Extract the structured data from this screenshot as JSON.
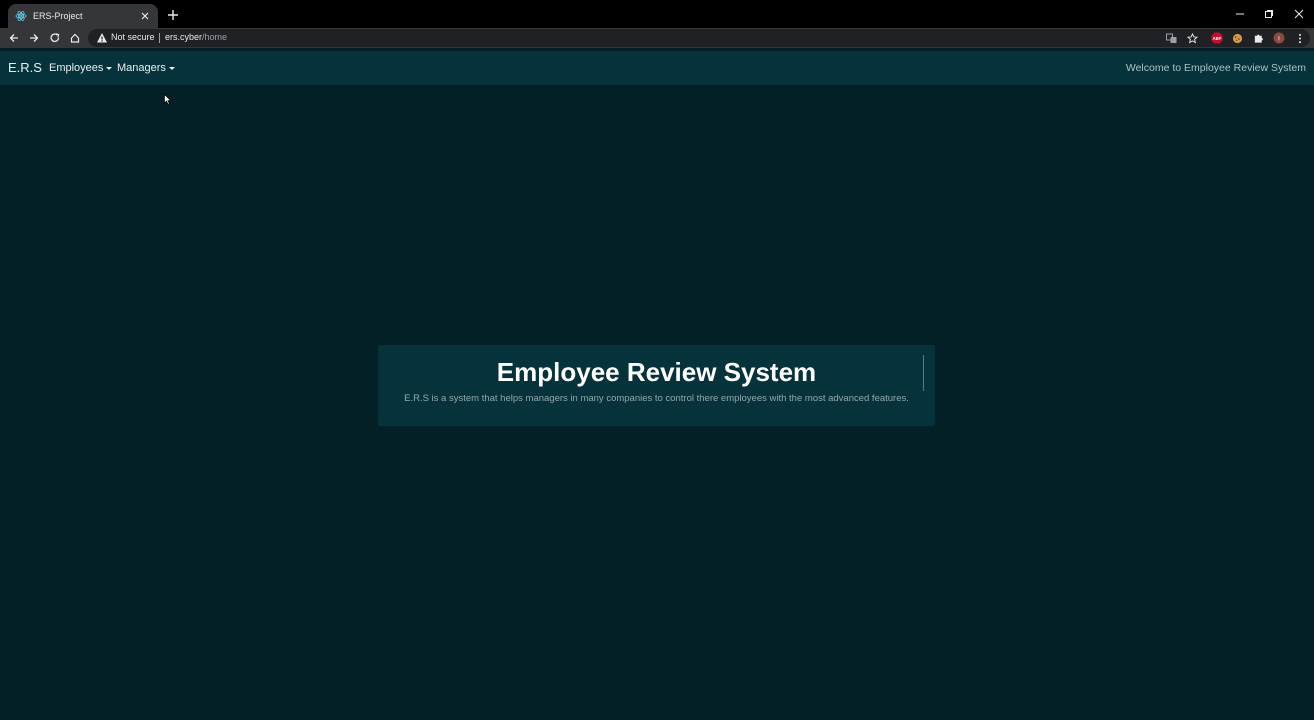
{
  "browser": {
    "tab_title": "ERS-Project",
    "security_text": "Not secure",
    "url_host": "ers.cyber",
    "url_path": "/home",
    "extensions": [
      "translate-icon",
      "star-icon",
      "adblock-icon",
      "cookie-icon",
      "puzzle-icon",
      "profile-icon",
      "kebab-menu-icon"
    ],
    "extension_labels": {
      "adblock": "ABP",
      "profile": "I"
    }
  },
  "navbar": {
    "brand": "E.R.S",
    "items": [
      {
        "label": "Employees"
      },
      {
        "label": "Managers"
      }
    ],
    "welcome": "Welcome to Employee Review System"
  },
  "jumbotron": {
    "title": "Employee Review System",
    "description": "E.R.S is a system that helps managers in many companies to control there employees with the most advanced features."
  },
  "colors": {
    "page_bg": "#042027",
    "navbar_bg": "#06333b",
    "jumbotron_bg": "#06333b",
    "accent": "#19b6c4"
  }
}
